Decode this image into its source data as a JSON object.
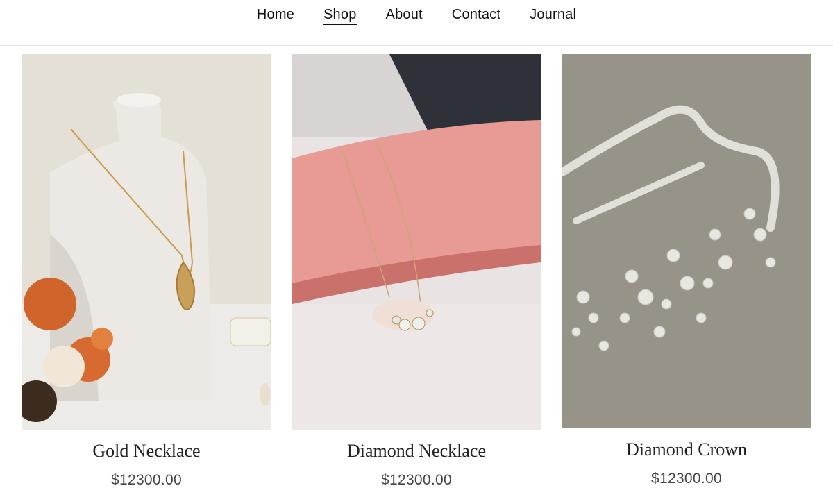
{
  "nav": {
    "items": [
      {
        "label": "Home",
        "active": false
      },
      {
        "label": "Shop",
        "active": true
      },
      {
        "label": "About",
        "active": false
      },
      {
        "label": "Contact",
        "active": false
      },
      {
        "label": "Journal",
        "active": false
      }
    ]
  },
  "products": [
    {
      "name": "Gold Necklace",
      "price": "$12300.00",
      "image": "gold-necklace-on-bust-photo"
    },
    {
      "name": "Diamond Necklace",
      "price": "$12300.00",
      "image": "diamond-necklace-on-pink-roll-photo"
    },
    {
      "name": "Diamond Crown",
      "price": "$12300.00",
      "image": "diamond-crown-on-linen-photo"
    }
  ]
}
